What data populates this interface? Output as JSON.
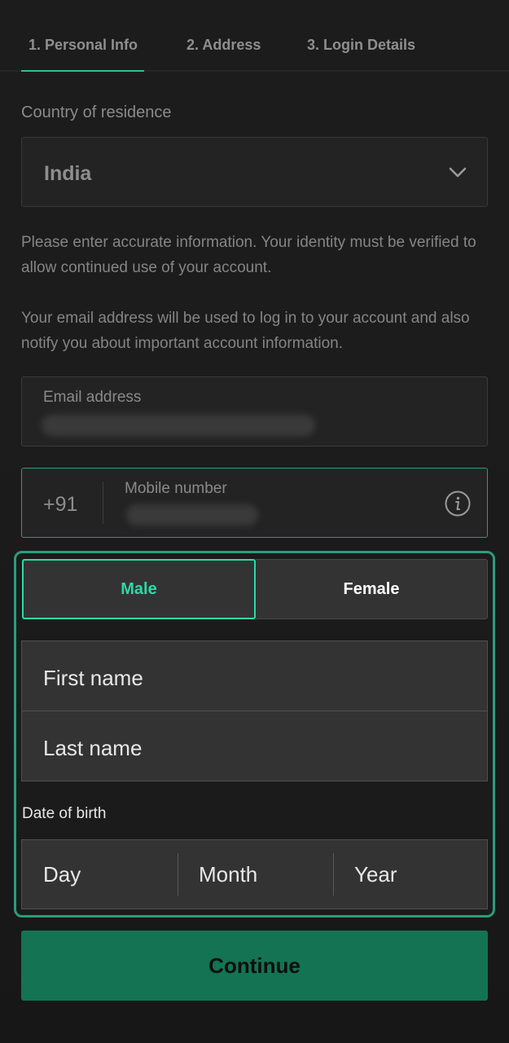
{
  "tabs": [
    {
      "label": "1.  Personal Info"
    },
    {
      "label": "2.  Address"
    },
    {
      "label": "3.  Login Details"
    }
  ],
  "country": {
    "label": "Country of residence",
    "value": "India"
  },
  "info": {
    "identity": "Please enter accurate information. Your identity must be verified to allow continued use of your account.",
    "email_note": "Your email address will be used to log in to your account and also notify you about important account information."
  },
  "email": {
    "label": "Email address"
  },
  "mobile": {
    "prefix": "+91",
    "label": "Mobile number"
  },
  "gender": {
    "male": "Male",
    "female": "Female",
    "selected": "Male"
  },
  "name": {
    "first_placeholder": "First name",
    "last_placeholder": "Last name"
  },
  "dob": {
    "label": "Date of birth",
    "day": "Day",
    "month": "Month",
    "year": "Year"
  },
  "continue_label": "Continue",
  "colors": {
    "accent": "#2bdaa6",
    "button": "#137352"
  }
}
